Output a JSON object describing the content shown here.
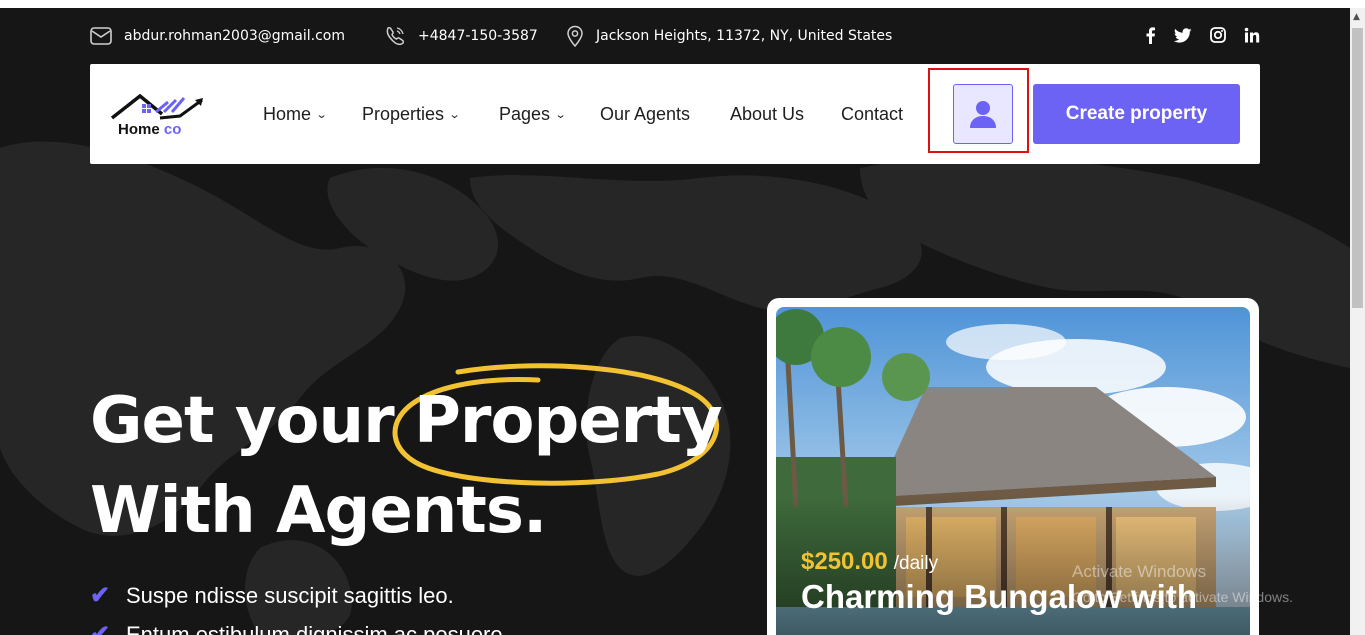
{
  "topbar": {
    "email": "abdur.rohman2003@gmail.com",
    "phone": "+4847-150-3587",
    "address": "Jackson Heights, 11372, NY, United States",
    "social": [
      "facebook",
      "twitter",
      "instagram",
      "linkedin"
    ]
  },
  "logo": {
    "name": "Home",
    "suffix": "co"
  },
  "nav": {
    "items": [
      {
        "label": "Home",
        "dropdown": true
      },
      {
        "label": "Properties",
        "dropdown": true
      },
      {
        "label": "Pages",
        "dropdown": true
      },
      {
        "label": "Our Agents",
        "dropdown": false
      },
      {
        "label": "About Us",
        "dropdown": false
      },
      {
        "label": "Contact",
        "dropdown": false
      }
    ],
    "user_icon": "user-icon",
    "create_label": "Create property"
  },
  "hero": {
    "line1_prefix": "Get your",
    "highlight": "Property",
    "line2": "With Agents.",
    "bullets": [
      "Suspe ndisse suscipit sagittis leo.",
      "Entum estibulum dignissim ac posuere."
    ]
  },
  "card": {
    "price": "$250.00",
    "period": "/daily",
    "title": "Charming Bungalow with"
  },
  "watermark": {
    "line1": "Activate Windows",
    "line2": "Go to Settings to activate Windows."
  },
  "colors": {
    "accent": "#6c63f5",
    "price": "#f2c232",
    "background": "#161616",
    "highlight_ring": "#f2c232",
    "selection_box": "#e01010"
  }
}
